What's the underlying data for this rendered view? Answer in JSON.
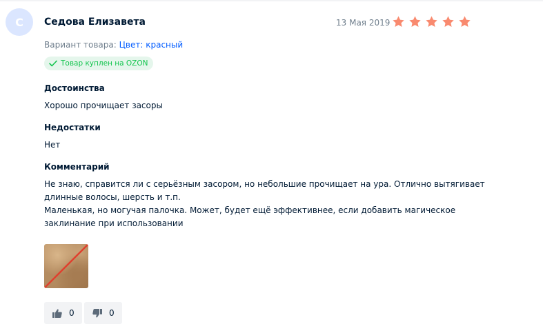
{
  "review": {
    "avatar_letter": "С",
    "author": "Седова Елизавета",
    "date": "13 Мая 2019",
    "rating": 5,
    "star_color": "#f98a6f",
    "variant_label": "Вариант товара:",
    "variant_value": "Цвет: красный",
    "verified_badge": "Товар куплен на OZON",
    "pros_title": "Достоинства",
    "pros_text": "Хорошо прочищает засоры",
    "cons_title": "Недостатки",
    "cons_text": "Нет",
    "comment_title": "Комментарий",
    "comment_lines": [
      "Не знаю, справится ли с серьёзным засором, но небольшие прочищает на ура. Отлично вытягивает длинные волосы, шерсть и т.п.",
      "Маленькая, но могучая палочка. Может, будет ещё эффективнее, если добавить магическое заклинание при использовании"
    ],
    "photo_icon": "review-photo",
    "likes": "0",
    "dislikes": "0"
  }
}
